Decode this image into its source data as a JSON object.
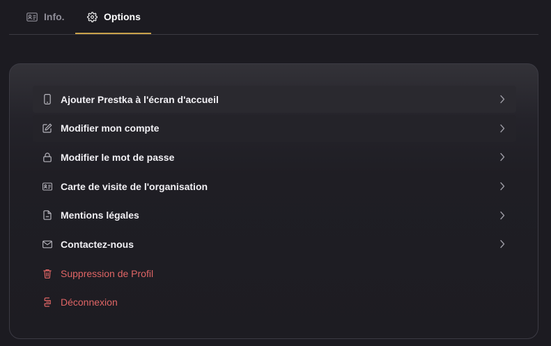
{
  "tabs": [
    {
      "label": "Info.",
      "icon": "id-card-icon",
      "active": false
    },
    {
      "label": "Options",
      "icon": "gear-icon",
      "active": true
    }
  ],
  "colors": {
    "background": "#1c1b21",
    "accent": "#c9a24a",
    "danger": "#e06565",
    "text": "#f1f0f4",
    "muted": "#8f8e98"
  },
  "menu": {
    "items": [
      {
        "label": "Ajouter Prestka à l'écran d'accueil",
        "icon": "smartphone-icon",
        "chevron": true
      },
      {
        "label": "Modifier mon compte",
        "icon": "edit-icon",
        "chevron": true
      },
      {
        "label": "Modifier le mot de passe",
        "icon": "lock-icon",
        "chevron": true
      },
      {
        "label": "Carte de visite de l'organisation",
        "icon": "business-card-icon",
        "chevron": true
      },
      {
        "label": "Mentions légales",
        "icon": "document-icon",
        "chevron": true
      },
      {
        "label": "Contactez-nous",
        "icon": "mail-icon",
        "chevron": true
      },
      {
        "label": "Suppression de Profil",
        "icon": "trash-icon",
        "chevron": false,
        "danger": true
      },
      {
        "label": "Déconnexion",
        "icon": "logout-icon",
        "chevron": false,
        "danger": true
      }
    ]
  }
}
